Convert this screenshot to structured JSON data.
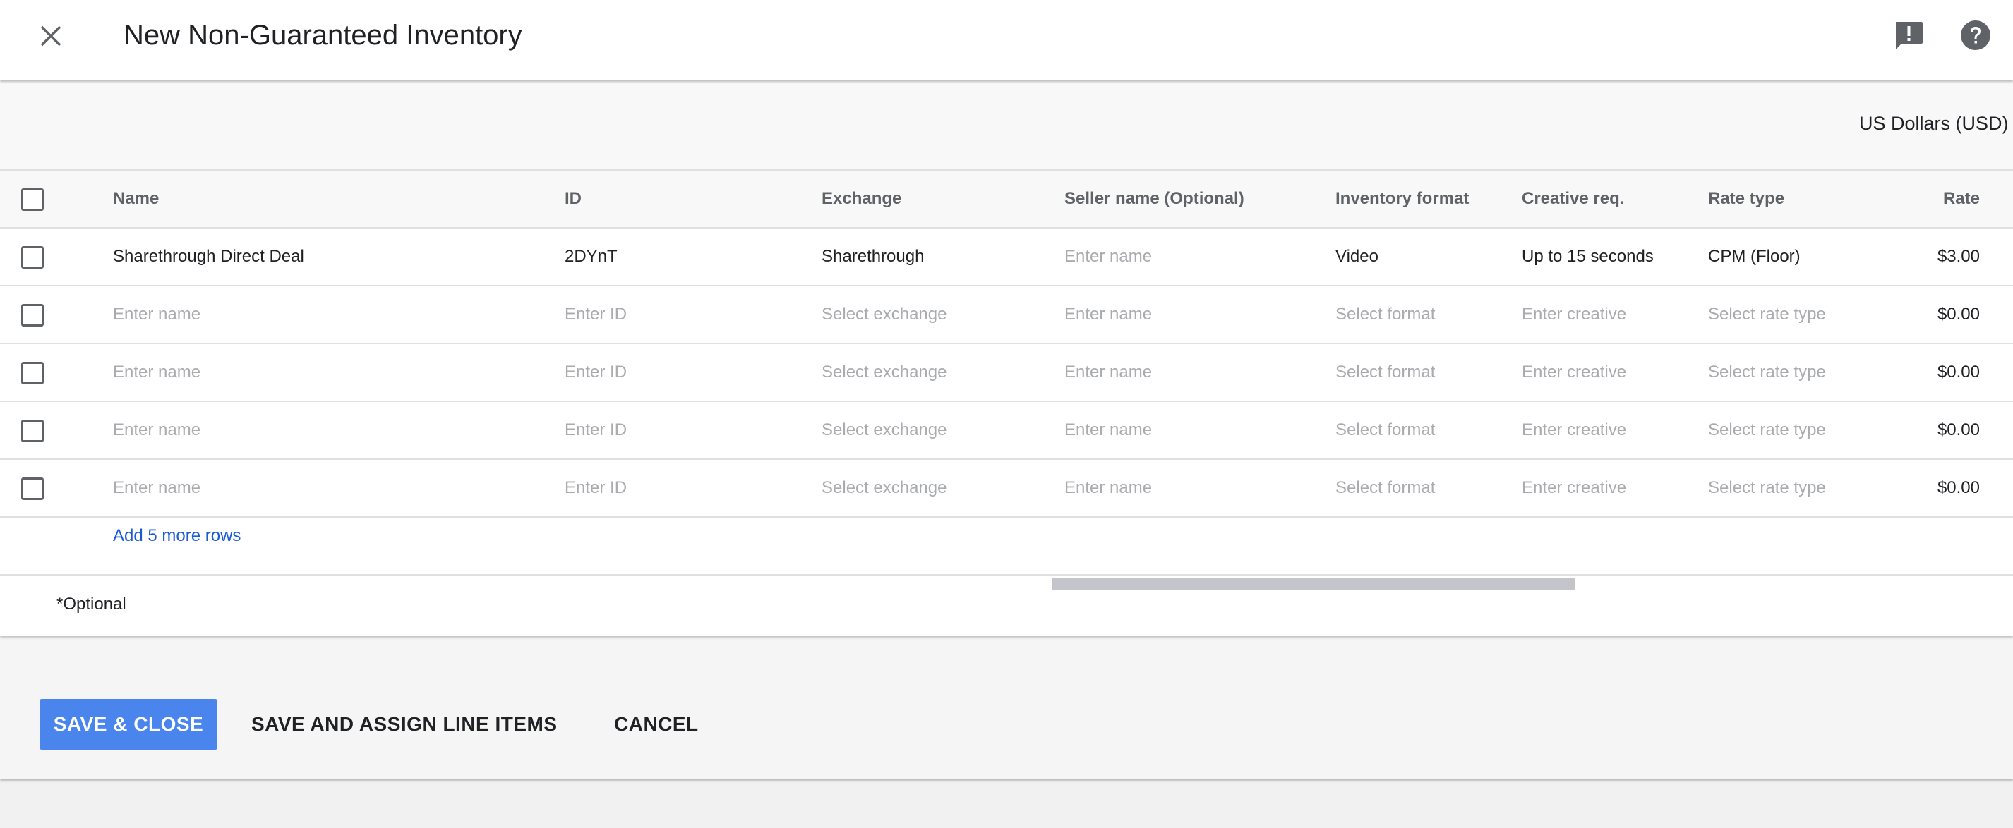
{
  "header": {
    "title": "New Non-Guaranteed Inventory"
  },
  "toolbar": {
    "currency": "US Dollars (USD)"
  },
  "table": {
    "columns": [
      "Name",
      "ID",
      "Exchange",
      "Seller name (Optional)",
      "Inventory format",
      "Creative req.",
      "Rate type",
      "Rate"
    ],
    "rows": [
      {
        "name": "Sharethrough Direct Deal",
        "id": "2DYnT",
        "exchange": "Sharethrough",
        "seller_name_placeholder": "Enter name",
        "inventory_format": "Video",
        "creative_req": "Up to 15 seconds",
        "rate_type": "CPM (Floor)",
        "rate": "$3.00"
      },
      {
        "name_placeholder": "Enter name",
        "id_placeholder": "Enter ID",
        "exchange_placeholder": "Select exchange",
        "seller_name_placeholder": "Enter name",
        "format_placeholder": "Select format",
        "creative_placeholder": "Enter creative",
        "rate_type_placeholder": "Select rate type",
        "rate": "$0.00"
      },
      {
        "name_placeholder": "Enter name",
        "id_placeholder": "Enter ID",
        "exchange_placeholder": "Select exchange",
        "seller_name_placeholder": "Enter name",
        "format_placeholder": "Select format",
        "creative_placeholder": "Enter creative",
        "rate_type_placeholder": "Select rate type",
        "rate": "$0.00"
      },
      {
        "name_placeholder": "Enter name",
        "id_placeholder": "Enter ID",
        "exchange_placeholder": "Select exchange",
        "seller_name_placeholder": "Enter name",
        "format_placeholder": "Select format",
        "creative_placeholder": "Enter creative",
        "rate_type_placeholder": "Select rate type",
        "rate": "$0.00"
      },
      {
        "name_placeholder": "Enter name",
        "id_placeholder": "Enter ID",
        "exchange_placeholder": "Select exchange",
        "seller_name_placeholder": "Enter name",
        "format_placeholder": "Select format",
        "creative_placeholder": "Enter creative",
        "rate_type_placeholder": "Select rate type",
        "rate": "$0.00"
      }
    ],
    "add_rows_label": "Add 5 more rows",
    "optional_note": "*Optional"
  },
  "footer": {
    "save_close_label": "SAVE & CLOSE",
    "save_assign_label": "SAVE AND ASSIGN LINE ITEMS",
    "cancel_label": "CANCEL"
  },
  "icons": {
    "close": "close-icon",
    "feedback": "feedback-icon",
    "help": "help-icon",
    "dropdown": "chevron-down-icon",
    "checkbox": "checkbox-icon"
  },
  "colors": {
    "primary_button": "#4a85ee",
    "link": "#1a5bd6",
    "placeholder": "#a9abae",
    "scrollbar": "#c4c5ca"
  }
}
